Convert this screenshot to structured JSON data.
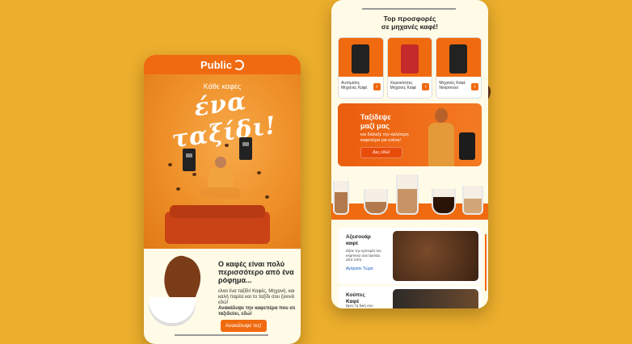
{
  "brand_color": "#f06a0f",
  "background_color": "#ecae2c",
  "left_screen": {
    "header": {
      "logo": "Public"
    },
    "hero": {
      "kicker": "Κάθε καφές",
      "headline": "ένα ταξίδι!"
    },
    "body": {
      "headline": "Ο καφές είναι πολύ περισσότερο από ένα ρόφημα...",
      "paragraph": "είναι ένα ταξίδι! Καφές, Μηχανή, και καλή παρέα και το ταξίδι σου ξεκινά εδώ!",
      "emphasis": "Ανακάλυψε την καφετιέρα που σε ταξιδεύει, εδώ!",
      "cta": "Ανακάλυψε τες!"
    }
  },
  "right_screen": {
    "title_line1": "Top προσφορές",
    "title_line2": "σε μηχανές καφέ!",
    "products": [
      {
        "label": "Αυτόματες Μηχανές Καφέ",
        "icon": "arrow-right-icon"
      },
      {
        "label": "Χειροκίνητες Μηχανές Καφέ",
        "icon": "arrow-right-icon"
      },
      {
        "label": "Μηχανές Καφέ Nespresso",
        "icon": "arrow-right-icon"
      }
    ],
    "banner": {
      "title_line1": "Ταξίδεψε",
      "title_line2": "μαζί μας",
      "subtitle": "και διάλεξε την καλύτερη καφετιέρα για εσένα!",
      "cta": "Δες εδώ!"
    },
    "sections": [
      {
        "title_line1": "Αξεσουάρ",
        "title_line2": "καφέ",
        "desc": "Ζήσε την εμπειρία του espresso σαν barista από σπίτι.",
        "link": "Αγόρασε Τώρα"
      },
      {
        "title_line1": "Κούπες",
        "title_line2": "Καφέ",
        "desc": "Βρες τη δική σου",
        "link": ""
      }
    ]
  }
}
